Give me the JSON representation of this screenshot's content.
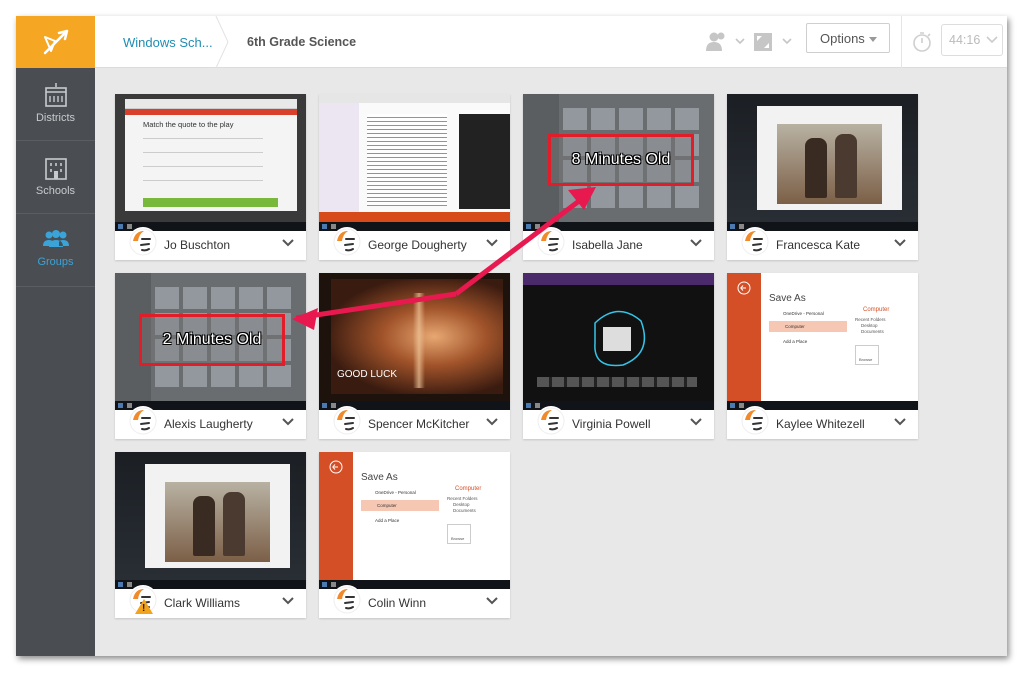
{
  "header": {
    "breadcrumb_school": "Windows Sch...",
    "breadcrumb_class": "6th Grade Science",
    "options_label": "Options",
    "timer": "44:16"
  },
  "sidebar": {
    "items": [
      {
        "label": "Districts",
        "icon": "district-building-icon",
        "active": false
      },
      {
        "label": "Schools",
        "icon": "school-building-icon",
        "active": false
      },
      {
        "label": "Groups",
        "icon": "groups-icon",
        "active": true
      }
    ]
  },
  "students": [
    {
      "name": "Jo Buschton",
      "screen": "quiz",
      "thumb_text": "Match the quote to the play",
      "thumb_title": "Office Mix"
    },
    {
      "name": "George Dougherty",
      "screen": "document"
    },
    {
      "name": "Isabella Jane",
      "screen": "start-menu"
    },
    {
      "name": "Francesca Kate",
      "screen": "photo"
    },
    {
      "name": "Alexis Laugherty",
      "screen": "start-menu"
    },
    {
      "name": "Spencer McKitcher",
      "screen": "hourglass",
      "thumb_text": "GOOD LUCK"
    },
    {
      "name": "Virginia Powell",
      "screen": "drawing"
    },
    {
      "name": "Kaylee Whitezell",
      "screen": "save-as",
      "thumb_text": "Save As"
    },
    {
      "name": "Clark Williams",
      "screen": "photo",
      "warning": true
    },
    {
      "name": "Colin Winn",
      "screen": "save-as",
      "thumb_text": "Save As"
    }
  ],
  "annotations": {
    "box1": "8 Minutes Old",
    "box2": "2 Minutes Old"
  },
  "save_as": {
    "onedrive": "OneDrive - Personal",
    "computer": "Computer",
    "add_place": "Add a Place",
    "computer_heading": "Computer",
    "recent": "Recent Folders",
    "desktop": "Desktop",
    "documents": "Documents",
    "browse": "Browse"
  },
  "colors": {
    "brand_orange": "#f5a623",
    "sidebar": "#4a4e52",
    "accent_blue": "#3aa3d8",
    "annotation_red": "#e11d2a",
    "arrow_pink": "#e8194f"
  }
}
